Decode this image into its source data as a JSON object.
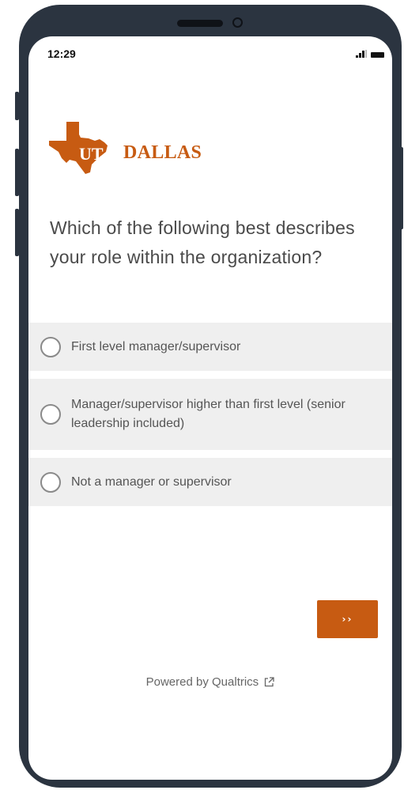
{
  "status_bar": {
    "time": "12:29",
    "signal_icon": "signal-icon",
    "battery_icon": "battery-icon"
  },
  "logo": {
    "ut_text": "UT",
    "name_text": "DALLAS",
    "color": "#c75b12"
  },
  "survey": {
    "question": "Which of the following best describes your role within the organization?",
    "choices": [
      {
        "label": "First level manager/supervisor",
        "selected": false
      },
      {
        "label": "Manager/supervisor higher than first level (senior leadership included)",
        "selected": false
      },
      {
        "label": "Not a manager or supervisor",
        "selected": false
      }
    ],
    "next_label": "››"
  },
  "footer": {
    "powered_by": "Powered by Qualtrics",
    "external_link_icon": "external-link-icon"
  },
  "colors": {
    "accent": "#c75b12",
    "choice_bg": "#efefef",
    "device_frame": "#2b3440"
  }
}
